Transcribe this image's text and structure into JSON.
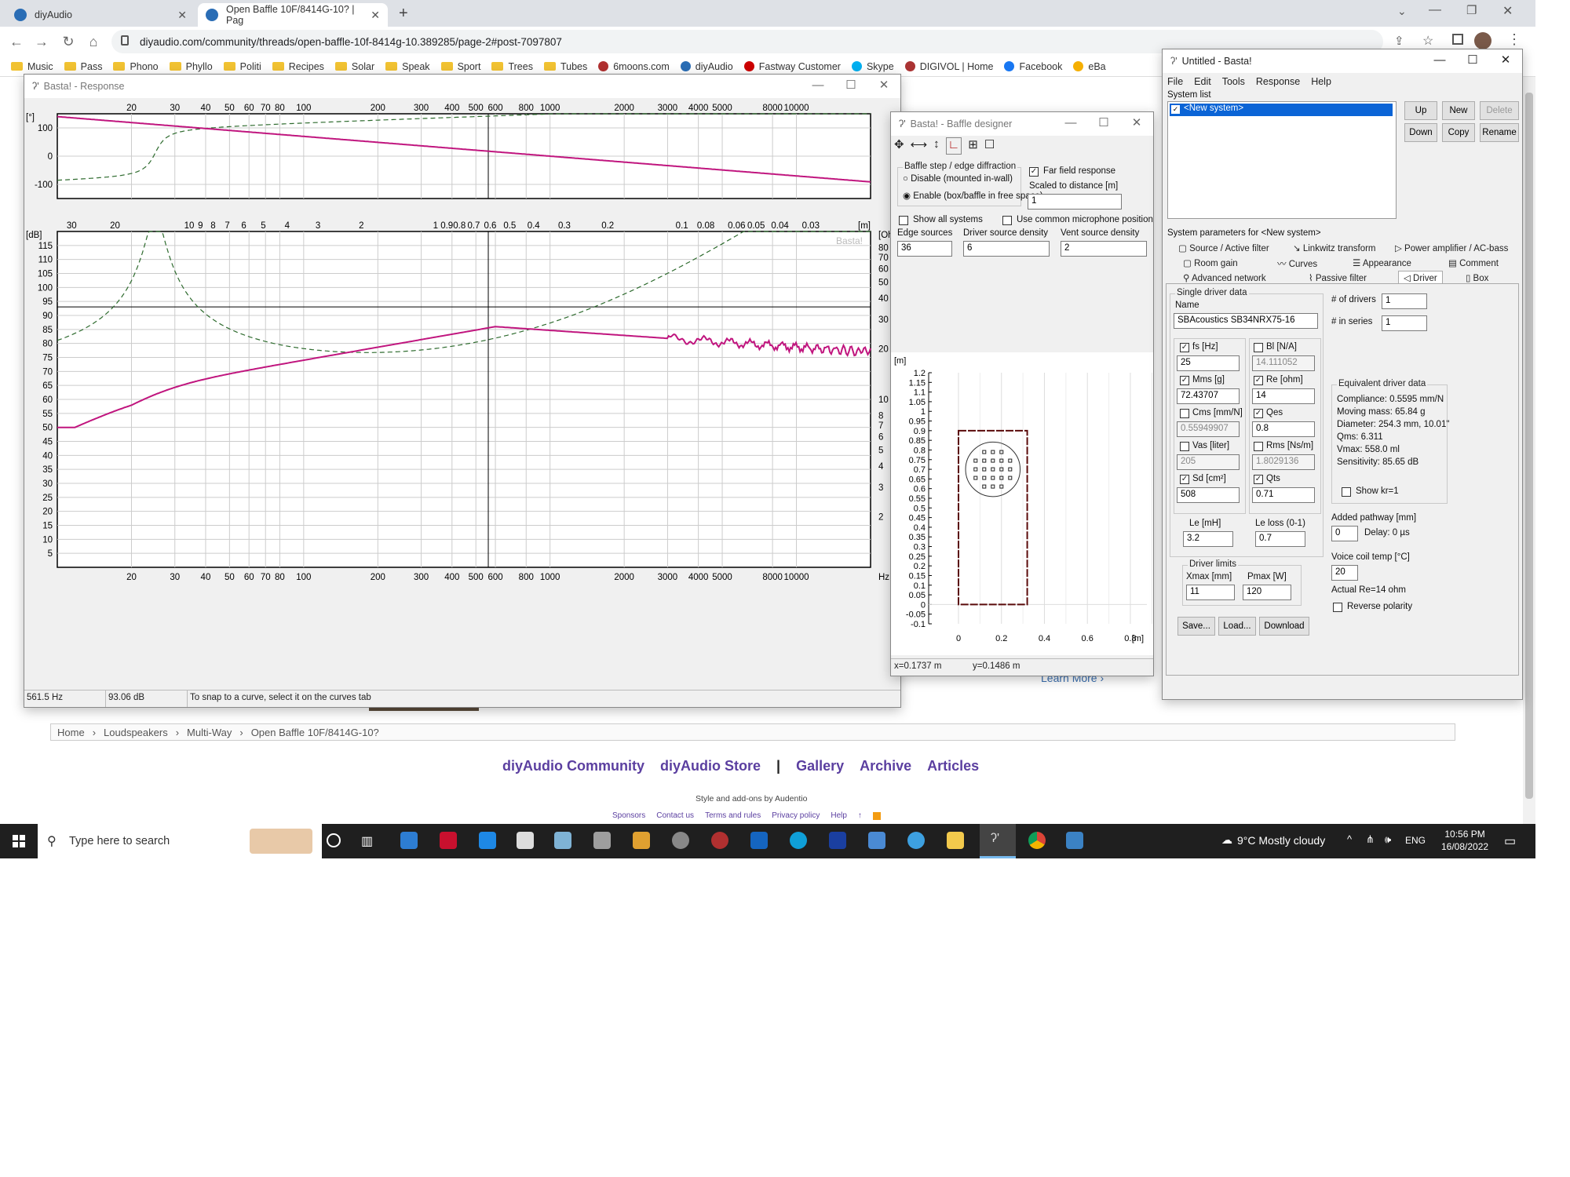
{
  "browser": {
    "tabs": [
      {
        "title": "diyAudio"
      },
      {
        "title": "Open Baffle 10F/8414G-10? | Pag"
      }
    ],
    "new_tab": "+",
    "url": "diyaudio.com/community/threads/open-baffle-10f-8414g-10.389285/page-2#post-7097807",
    "bookmarks": [
      "Music",
      "Pass",
      "Phono",
      "Phyllo",
      "Politi",
      "Recipes",
      "Solar",
      "Speak",
      "Sport",
      "Trees",
      "Tubes",
      "6moons.com",
      "diyAudio",
      "Fastway Customer",
      "Skype",
      "DIGIVOL | Home",
      "Facebook",
      "eBa"
    ]
  },
  "page": {
    "breadcrumb": [
      "Home",
      "Loudspeakers",
      "Multi-Way",
      "Open Baffle 10F/8414G-10?"
    ],
    "footer_links": [
      "diyAudio Community",
      "diyAudio Store",
      "|",
      "Gallery",
      "Archive",
      "Articles"
    ],
    "style_credit": "Style and add-ons by Audentio",
    "footer_small": [
      "Sponsors",
      "Contact us",
      "Terms and rules",
      "Privacy policy",
      "Help"
    ],
    "learn_more": "Learn More"
  },
  "response_window": {
    "title": "Basta! - Response",
    "phase_unit": "[°]",
    "phase_ticks": [
      "100",
      "0",
      "-100"
    ],
    "db_unit": "[dB]",
    "db_ticks": [
      "115",
      "110",
      "105",
      "100",
      "95",
      "90",
      "85",
      "80",
      "75",
      "70",
      "65",
      "60",
      "55",
      "50",
      "45",
      "40",
      "35",
      "30",
      "25",
      "20",
      "15",
      "10",
      "5"
    ],
    "right_ticks": [
      "80",
      "70",
      "60",
      "50",
      "40",
      "30",
      "20",
      "10",
      "8",
      "7",
      "6",
      "5",
      "4",
      "3",
      "2"
    ],
    "right_unit": "[Oh",
    "hz_ticks": [
      "20",
      "30",
      "40",
      "50",
      "60",
      "70",
      "80",
      "100",
      "200",
      "300",
      "400",
      "500",
      "600",
      "800",
      "1000",
      "2000",
      "3000",
      "4000",
      "5000",
      "8000",
      "10000"
    ],
    "hz_unit": "Hz",
    "wavelength_ticks": [
      "30",
      "20",
      "10",
      "9",
      "8",
      "7",
      "6",
      "5",
      "4",
      "3",
      "2",
      "1",
      "0.9",
      "0.8",
      "0.7",
      "0.6",
      "0.5",
      "0.4",
      "0.3",
      "0.2",
      "0.1",
      "0.08",
      "0.06",
      "0.05",
      "0.04",
      "0.03"
    ],
    "wavelength_unit": "[m]",
    "watermark": "Basta!",
    "status": [
      "561.5 Hz",
      "93.06 dB",
      "To snap to a curve, select it on the curves tab"
    ]
  },
  "baffle_window": {
    "title": "Basta! - Baffle designer",
    "group_label": "Baffle step / edge diffraction",
    "radio_disable": "Disable (mounted in-wall)",
    "radio_enable": "Enable (box/baffle in free space)",
    "far_field": "Far field response",
    "scaled": "Scaled to distance [m]",
    "scaled_value": "1",
    "show_all": "Show all systems",
    "common_mic": "Use common microphone position",
    "edge_sources_label": "Edge sources",
    "edge_sources": "36",
    "driver_density_label": "Driver source density",
    "driver_density": "6",
    "vent_density_label": "Vent source density",
    "vent_density": "2",
    "y_unit": "[m]",
    "y_ticks": [
      "1.2",
      "1.15",
      "1.1",
      "1.05",
      "1",
      "0.95",
      "0.9",
      "0.85",
      "0.8",
      "0.75",
      "0.7",
      "0.65",
      "0.6",
      "0.55",
      "0.5",
      "0.45",
      "0.4",
      "0.35",
      "0.3",
      "0.25",
      "0.2",
      "0.15",
      "0.1",
      "0.05",
      "0",
      "-0.05",
      "-0.1"
    ],
    "x_ticks": [
      "0",
      "0.2",
      "0.4",
      "0.6",
      "0.8"
    ],
    "x_unit": "[m]",
    "status_x": "x=0.1737 m",
    "status_y": "y=0.1486 m"
  },
  "basta_window": {
    "title": "Untitled - Basta!",
    "menu": [
      "File",
      "Edit",
      "Tools",
      "Response",
      "Help"
    ],
    "system_list_label": "System list",
    "system_item": "<New system>",
    "buttons": [
      "Up",
      "New",
      "Delete",
      "Down",
      "Copy",
      "Rename"
    ],
    "params_label": "System parameters for <New system>",
    "tabs_row1": [
      "Source / Active filter",
      "Linkwitz transform",
      "Power amplifier / AC-bass"
    ],
    "tabs_row2": [
      "Room gain",
      "Curves",
      "Appearance",
      "Comment"
    ],
    "tabs_row3": [
      "Advanced network",
      "Passive filter",
      "Driver",
      "Box"
    ],
    "single_driver_label": "Single driver data",
    "name_label": "Name",
    "name_value": "SBAcoustics SB34NRX75-16",
    "fs_label": "fs [Hz]",
    "fs": "25",
    "bl_label": "Bl [N/A]",
    "bl": "14.111052",
    "mms_label": "Mms [g]",
    "mms": "72.43707",
    "re_label": "Re [ohm]",
    "re": "14",
    "cms_label": "Cms [mm/N]",
    "cms": "0.55949907",
    "qes_label": "Qes",
    "qes": "0.8",
    "vas_label": "Vas [liter]",
    "vas": "205",
    "rms_label": "Rms [Ns/m]",
    "rms": "1.8029136",
    "sd_label": "Sd [cm²]",
    "sd": "508",
    "qts_label": "Qts",
    "qts": "0.71",
    "le_label": "Le [mH]",
    "le": "3.2",
    "le_loss_label": "Le loss (0-1)",
    "le_loss": "0.7",
    "limits_label": "Driver limits",
    "xmax_label": "Xmax [mm]",
    "xmax": "11",
    "pmax_label": "Pmax [W]",
    "pmax": "120",
    "save": "Save...",
    "load": "Load...",
    "download": "Download",
    "drivers_label": "# of drivers",
    "drivers": "1",
    "series_label": "# in series",
    "series": "1",
    "equiv_label": "Equivalent driver data",
    "equiv": [
      "Compliance: 0.5595 mm/N",
      "Moving mass: 65.84 g",
      "Diameter: 254.3 mm, 10.01\"",
      "Qms: 6.311",
      "Vmax: 558.0 ml",
      "Sensitivity: 85.65 dB"
    ],
    "show_kr": "Show kr=1",
    "added_path_label": "Added pathway [mm]",
    "added_path": "0",
    "delay": "Delay: 0 µs",
    "vc_temp_label": "Voice coil temp [°C]",
    "vc_temp": "20",
    "actual_re": "Actual Re=14 ohm",
    "reverse": "Reverse polarity"
  },
  "taskbar": {
    "search": "Type here to search",
    "weather": "9°C  Mostly cloudy",
    "lang": "ENG",
    "time": "10:56 PM",
    "date": "16/08/2022"
  },
  "colors": {
    "spl_curve": "#c0157e",
    "impedance_curve": "#2e6b2e",
    "baffle": "#5a0a0a"
  }
}
